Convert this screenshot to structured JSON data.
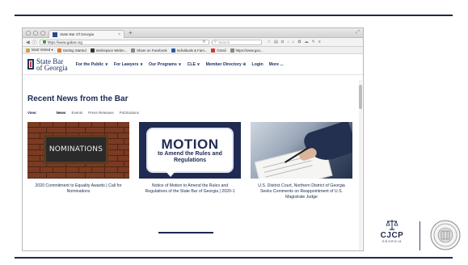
{
  "browser": {
    "tab_title": "State Bar Of Georgia",
    "tab_close": "×",
    "new_tab": "+",
    "url": "https://www.gabar.org",
    "search_placeholder": "Search",
    "bookmarks": [
      {
        "label": "Most Visited ▾",
        "color": "#c9a64a"
      },
      {
        "label": "Getting Started",
        "color": "#e07a2a"
      },
      {
        "label": "Workspace Webm...",
        "color": "#333333"
      },
      {
        "label": "Share on Facebook",
        "color": "#888888"
      },
      {
        "label": "Individuals & Fam...",
        "color": "#2a5ba8"
      },
      {
        "label": "Gmail",
        "color": "#d03a2a"
      },
      {
        "label": "https://www.goo...",
        "color": "#888888"
      }
    ]
  },
  "site": {
    "logo_line1": "State Bar",
    "logo_line2": "of Georgia",
    "nav": [
      "For the Public ∨",
      "For Lawyers ∨",
      "Our Programs ∨",
      "CLE ∨",
      "Member Directory ⊕",
      "Login",
      "More ..."
    ]
  },
  "main": {
    "section_title": "Recent News from the Bar",
    "filter_label": "View:",
    "filters": [
      {
        "label": "News",
        "active": true
      },
      {
        "label": "Events",
        "active": false
      },
      {
        "label": "Press Releases",
        "active": false
      },
      {
        "label": "Publications",
        "active": false
      }
    ],
    "cards": [
      {
        "image_text": "NOMINATIONS",
        "caption": "2020 Commitment to Equality Awards | Call for Nominations"
      },
      {
        "image_head": "MOTION",
        "image_sub": "to Amend the Rules and Regulations",
        "caption": "Notice of Motion to Amend the Rules and Regulations of the State Bar of Georgia | 2020-1"
      },
      {
        "caption": "U.S. District Court, Northern District of Georgia Seeks Comments on Reappointment of U.S. Magistrate Judge"
      }
    ]
  },
  "logos": {
    "cjcp_text": "CJCP",
    "cjcp_sub": "GEORGIA"
  },
  "colors": {
    "navy": "#1c3264",
    "accent_rule": "#1f2a4a"
  }
}
